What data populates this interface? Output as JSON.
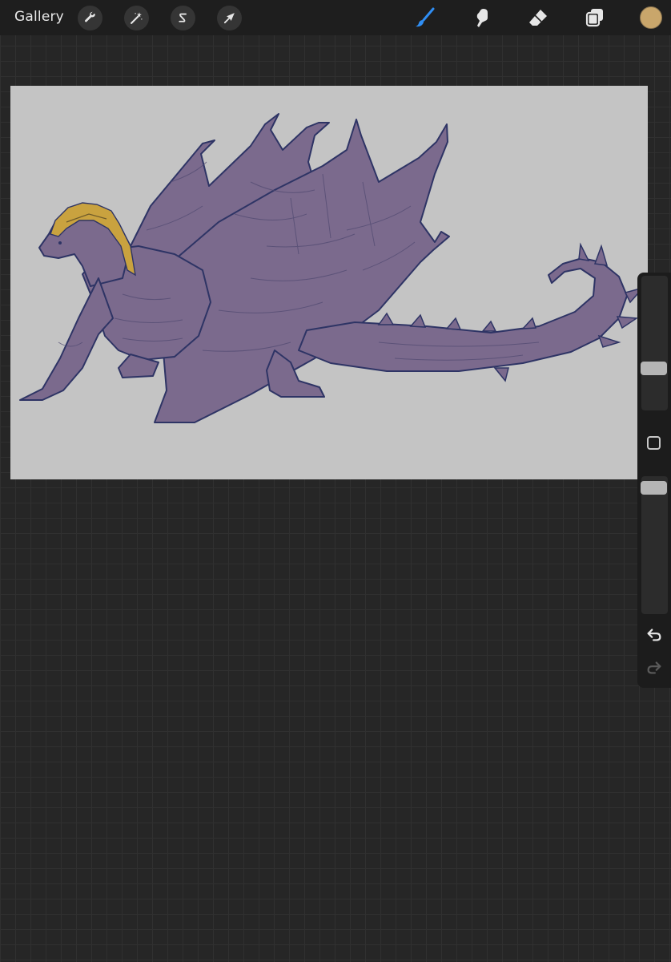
{
  "toolbar": {
    "gallery_label": "Gallery",
    "left_tools": [
      {
        "name": "actions",
        "icon": "wrench-icon"
      },
      {
        "name": "adjustments",
        "icon": "magic-wand-icon"
      },
      {
        "name": "selection",
        "icon": "selection-s-icon"
      },
      {
        "name": "transform",
        "icon": "arrow-cursor-icon"
      }
    ],
    "right_tools": [
      {
        "name": "brush",
        "icon": "brush-icon",
        "active": true
      },
      {
        "name": "smudge",
        "icon": "smudge-icon",
        "active": false
      },
      {
        "name": "eraser",
        "icon": "eraser-icon",
        "active": false
      },
      {
        "name": "layers",
        "icon": "layers-icon",
        "active": false
      }
    ],
    "current_color": "#c9a66b"
  },
  "canvas": {
    "background": "#c4c4c4",
    "artwork": "dragon-illustration",
    "colors": {
      "body": "#7b6a8d",
      "line": "#2e3465",
      "crest": "#c9a23f"
    }
  },
  "sidebar": {
    "brush_size_level": 0.29,
    "opacity_level": 0.96,
    "icons": [
      "modify-square-icon",
      "undo-icon",
      "redo-icon"
    ]
  },
  "theme": {
    "accent": "#2f8ef4",
    "background": "#262626",
    "toolbar": "#1e1e1e"
  }
}
